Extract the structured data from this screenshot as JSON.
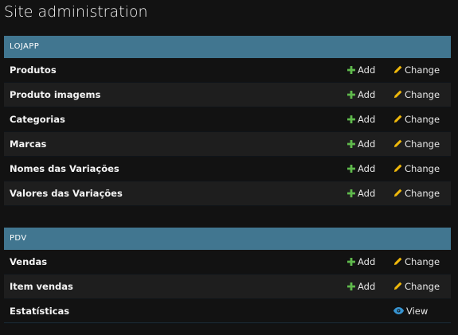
{
  "page": {
    "title": "Site administration"
  },
  "colors": {
    "caption_bg": "#417690",
    "add_icon": "#5fb94c",
    "change_icon": "#efb80b",
    "view_icon": "#3794d1"
  },
  "modules": [
    {
      "caption": "LOJAPP",
      "rows": [
        {
          "label": "Produtos",
          "add": "Add",
          "change": "Change"
        },
        {
          "label": "Produto imagems",
          "add": "Add",
          "change": "Change"
        },
        {
          "label": "Categorias",
          "add": "Add",
          "change": "Change"
        },
        {
          "label": "Marcas",
          "add": "Add",
          "change": "Change"
        },
        {
          "label": "Nomes das Variações",
          "add": "Add",
          "change": "Change"
        },
        {
          "label": "Valores das Variações",
          "add": "Add",
          "change": "Change"
        }
      ]
    },
    {
      "caption": "PDV",
      "rows": [
        {
          "label": "Vendas",
          "add": "Add",
          "change": "Change"
        },
        {
          "label": "Item vendas",
          "add": "Add",
          "change": "Change"
        },
        {
          "label": "Estatísticas",
          "view": "View"
        }
      ]
    }
  ],
  "icons": {
    "add": "plus-icon",
    "change": "pencil-icon",
    "view": "eye-icon"
  }
}
